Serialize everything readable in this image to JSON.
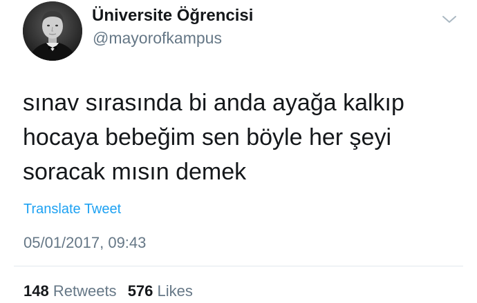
{
  "author": {
    "display_name": "Üniversite Öğrencisi",
    "username": "@mayorofkampus",
    "avatar": "avatar-photo"
  },
  "tweet": {
    "text": "sınav sırasında bi anda ayağa kalkıp\nhocaya bebeğim sen böyle her şeyi\nsoracak mısın demek",
    "translate_label": "Translate Tweet",
    "timestamp": "05/01/2017, 09:43"
  },
  "stats": {
    "retweets_count": "148",
    "retweets_label": "Retweets",
    "likes_count": "576",
    "likes_label": "Likes"
  },
  "icons": {
    "menu": "chevron-down-icon"
  },
  "colors": {
    "link": "#1da1f2",
    "secondary_text": "#657786",
    "primary_text": "#14171a",
    "divider": "#e1e8ed"
  }
}
